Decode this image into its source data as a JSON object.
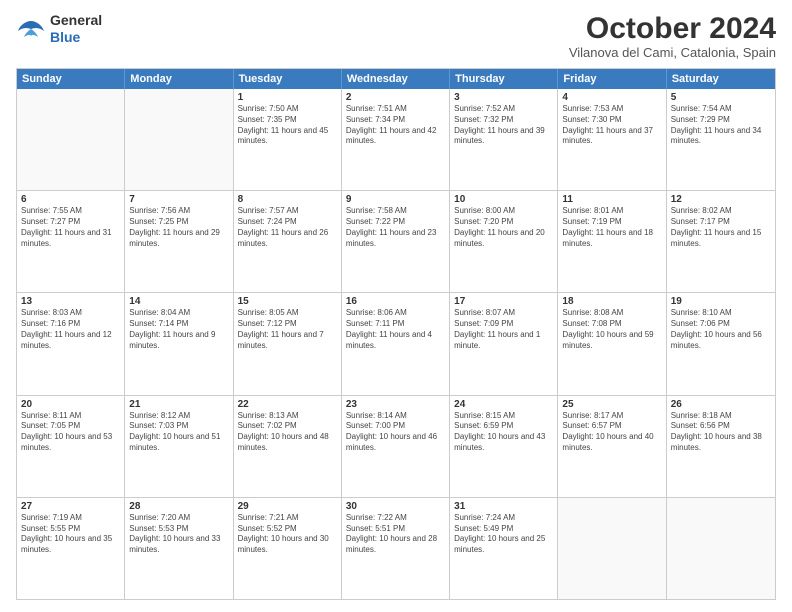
{
  "logo": {
    "line1": "General",
    "line2": "Blue"
  },
  "title": "October 2024",
  "location": "Vilanova del Cami, Catalonia, Spain",
  "headers": [
    "Sunday",
    "Monday",
    "Tuesday",
    "Wednesday",
    "Thursday",
    "Friday",
    "Saturday"
  ],
  "rows": [
    [
      {
        "day": "",
        "text": ""
      },
      {
        "day": "",
        "text": ""
      },
      {
        "day": "1",
        "text": "Sunrise: 7:50 AM\nSunset: 7:35 PM\nDaylight: 11 hours and 45 minutes."
      },
      {
        "day": "2",
        "text": "Sunrise: 7:51 AM\nSunset: 7:34 PM\nDaylight: 11 hours and 42 minutes."
      },
      {
        "day": "3",
        "text": "Sunrise: 7:52 AM\nSunset: 7:32 PM\nDaylight: 11 hours and 39 minutes."
      },
      {
        "day": "4",
        "text": "Sunrise: 7:53 AM\nSunset: 7:30 PM\nDaylight: 11 hours and 37 minutes."
      },
      {
        "day": "5",
        "text": "Sunrise: 7:54 AM\nSunset: 7:29 PM\nDaylight: 11 hours and 34 minutes."
      }
    ],
    [
      {
        "day": "6",
        "text": "Sunrise: 7:55 AM\nSunset: 7:27 PM\nDaylight: 11 hours and 31 minutes."
      },
      {
        "day": "7",
        "text": "Sunrise: 7:56 AM\nSunset: 7:25 PM\nDaylight: 11 hours and 29 minutes."
      },
      {
        "day": "8",
        "text": "Sunrise: 7:57 AM\nSunset: 7:24 PM\nDaylight: 11 hours and 26 minutes."
      },
      {
        "day": "9",
        "text": "Sunrise: 7:58 AM\nSunset: 7:22 PM\nDaylight: 11 hours and 23 minutes."
      },
      {
        "day": "10",
        "text": "Sunrise: 8:00 AM\nSunset: 7:20 PM\nDaylight: 11 hours and 20 minutes."
      },
      {
        "day": "11",
        "text": "Sunrise: 8:01 AM\nSunset: 7:19 PM\nDaylight: 11 hours and 18 minutes."
      },
      {
        "day": "12",
        "text": "Sunrise: 8:02 AM\nSunset: 7:17 PM\nDaylight: 11 hours and 15 minutes."
      }
    ],
    [
      {
        "day": "13",
        "text": "Sunrise: 8:03 AM\nSunset: 7:16 PM\nDaylight: 11 hours and 12 minutes."
      },
      {
        "day": "14",
        "text": "Sunrise: 8:04 AM\nSunset: 7:14 PM\nDaylight: 11 hours and 9 minutes."
      },
      {
        "day": "15",
        "text": "Sunrise: 8:05 AM\nSunset: 7:12 PM\nDaylight: 11 hours and 7 minutes."
      },
      {
        "day": "16",
        "text": "Sunrise: 8:06 AM\nSunset: 7:11 PM\nDaylight: 11 hours and 4 minutes."
      },
      {
        "day": "17",
        "text": "Sunrise: 8:07 AM\nSunset: 7:09 PM\nDaylight: 11 hours and 1 minute."
      },
      {
        "day": "18",
        "text": "Sunrise: 8:08 AM\nSunset: 7:08 PM\nDaylight: 10 hours and 59 minutes."
      },
      {
        "day": "19",
        "text": "Sunrise: 8:10 AM\nSunset: 7:06 PM\nDaylight: 10 hours and 56 minutes."
      }
    ],
    [
      {
        "day": "20",
        "text": "Sunrise: 8:11 AM\nSunset: 7:05 PM\nDaylight: 10 hours and 53 minutes."
      },
      {
        "day": "21",
        "text": "Sunrise: 8:12 AM\nSunset: 7:03 PM\nDaylight: 10 hours and 51 minutes."
      },
      {
        "day": "22",
        "text": "Sunrise: 8:13 AM\nSunset: 7:02 PM\nDaylight: 10 hours and 48 minutes."
      },
      {
        "day": "23",
        "text": "Sunrise: 8:14 AM\nSunset: 7:00 PM\nDaylight: 10 hours and 46 minutes."
      },
      {
        "day": "24",
        "text": "Sunrise: 8:15 AM\nSunset: 6:59 PM\nDaylight: 10 hours and 43 minutes."
      },
      {
        "day": "25",
        "text": "Sunrise: 8:17 AM\nSunset: 6:57 PM\nDaylight: 10 hours and 40 minutes."
      },
      {
        "day": "26",
        "text": "Sunrise: 8:18 AM\nSunset: 6:56 PM\nDaylight: 10 hours and 38 minutes."
      }
    ],
    [
      {
        "day": "27",
        "text": "Sunrise: 7:19 AM\nSunset: 5:55 PM\nDaylight: 10 hours and 35 minutes."
      },
      {
        "day": "28",
        "text": "Sunrise: 7:20 AM\nSunset: 5:53 PM\nDaylight: 10 hours and 33 minutes."
      },
      {
        "day": "29",
        "text": "Sunrise: 7:21 AM\nSunset: 5:52 PM\nDaylight: 10 hours and 30 minutes."
      },
      {
        "day": "30",
        "text": "Sunrise: 7:22 AM\nSunset: 5:51 PM\nDaylight: 10 hours and 28 minutes."
      },
      {
        "day": "31",
        "text": "Sunrise: 7:24 AM\nSunset: 5:49 PM\nDaylight: 10 hours and 25 minutes."
      },
      {
        "day": "",
        "text": ""
      },
      {
        "day": "",
        "text": ""
      }
    ]
  ]
}
